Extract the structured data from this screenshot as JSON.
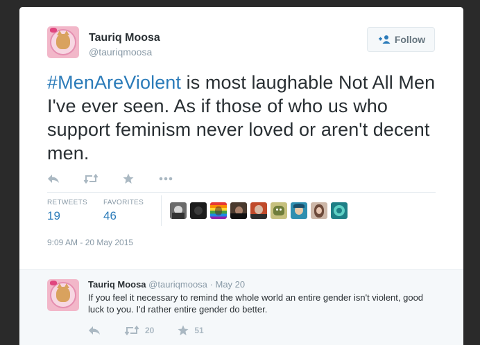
{
  "tweet": {
    "author": {
      "name": "Tauriq Moosa",
      "handle": "@tauriqmoosa"
    },
    "follow_label": "Follow",
    "hashtag": "#MenAreViolent",
    "text_rest": " is most laughable Not All Men I've ever seen. As if those of who us who support feminism never loved or aren't decent men.",
    "stats": {
      "retweets_label": "RETWEETS",
      "retweets": "19",
      "favorites_label": "FAVORITES",
      "favorites": "46"
    },
    "timestamp": "9:09 AM - 20 May 2015",
    "favoriter_avatars": [
      "avatar-1",
      "avatar-2",
      "avatar-3",
      "avatar-4",
      "avatar-5",
      "avatar-6",
      "avatar-7",
      "avatar-8",
      "avatar-9"
    ]
  },
  "reply": {
    "name": "Tauriq Moosa",
    "handle": "@tauriqmoosa",
    "separator": " · ",
    "date": "May 20",
    "text": "If you feel it necessary to remind the whole world an entire gender isn't violent, good luck to you. I'd rather entire gender do better.",
    "retweets": "20",
    "favorites": "51"
  },
  "colors": {
    "link": "#2b7bb9",
    "text": "#292f33",
    "muted": "#8899a6",
    "icon": "#aab8c2",
    "background": "#2a2a2a"
  },
  "icons": [
    "reply-icon",
    "retweet-icon",
    "favorite-icon",
    "more-icon",
    "add-user-icon"
  ]
}
